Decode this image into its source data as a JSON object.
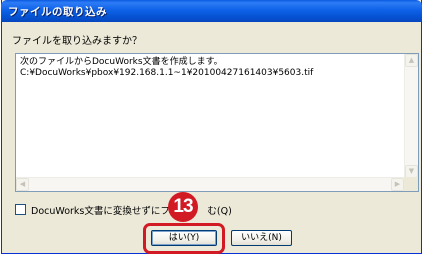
{
  "window": {
    "title": "ファイルの取り込み"
  },
  "dialog": {
    "prompt": "ファイルを取り込みますか？",
    "message_line1": "次のファイルからDocuWorks文書を作成します。",
    "message_line2": "C:¥DocuWorks¥pbox¥192.168.1.1~1¥20100427161403¥5603.tif",
    "checkbox_label": "DocuWorks文書に変換せずにファ",
    "checkbox_label_tail": "む(Q)",
    "checkbox_checked": false,
    "yes_button": "はい(Y)",
    "no_button": "いいえ(N)"
  },
  "annotation": {
    "step_number": "13",
    "color": "#D11A24"
  },
  "colors": {
    "titlebar": "#0553D4",
    "dialog_bg": "#ECE9D8",
    "border": "#0831D9"
  }
}
